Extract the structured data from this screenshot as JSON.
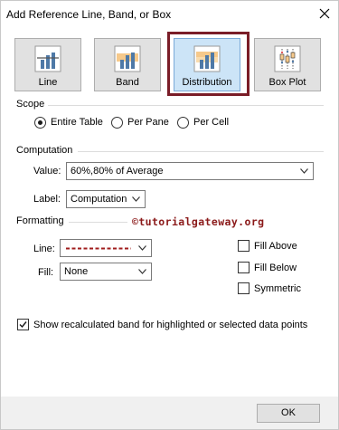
{
  "dialog": {
    "title": "Add Reference Line, Band, or Box"
  },
  "modes": [
    {
      "label": "Line",
      "icon": "reference-line-icon",
      "selected": false
    },
    {
      "label": "Band",
      "icon": "reference-band-icon",
      "selected": false
    },
    {
      "label": "Distribution",
      "icon": "distribution-icon",
      "selected": true
    },
    {
      "label": "Box Plot",
      "icon": "box-plot-icon",
      "selected": false
    }
  ],
  "scope": {
    "header": "Scope",
    "options": [
      {
        "label": "Entire Table",
        "checked": true
      },
      {
        "label": "Per Pane",
        "checked": false
      },
      {
        "label": "Per Cell",
        "checked": false
      }
    ]
  },
  "computation": {
    "header": "Computation",
    "value_label": "Value:",
    "value": "60%,80% of Average",
    "label_label": "Label:",
    "label_value": "Computation"
  },
  "formatting": {
    "header": "Formatting",
    "line_label": "Line:",
    "line_color": "#a01c1c",
    "fill_label": "Fill:",
    "fill_value": "None",
    "checkboxes": [
      {
        "label": "Fill Above",
        "checked": false
      },
      {
        "label": "Fill Below",
        "checked": false
      },
      {
        "label": "Symmetric",
        "checked": false
      }
    ]
  },
  "watermark": "©tutorialgateway.org",
  "show_recalculated": {
    "label": "Show recalculated band for highlighted or selected data points",
    "checked": true
  },
  "footer": {
    "ok_label": "OK"
  },
  "colors": {
    "accent_frame": "#7a1d28",
    "selected_tile": "#cce4f7",
    "band_fill": "#f6c98b",
    "bar_blue": "#4e79a7",
    "watermark": "#8b1a1a"
  }
}
